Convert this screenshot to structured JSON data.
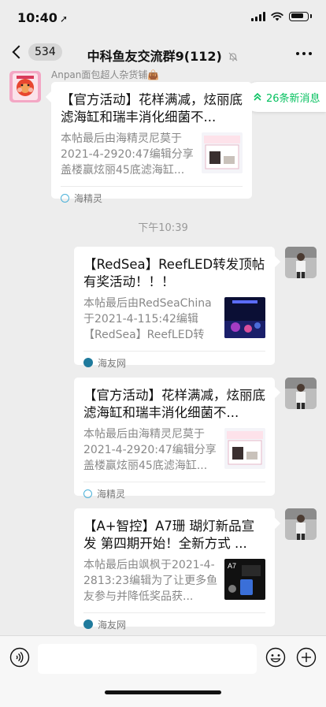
{
  "status_bar": {
    "time": "10:40",
    "location_icon": "location-arrow-icon"
  },
  "nav": {
    "back_count": "534",
    "title": "中科鱼友交流群9(112)",
    "mute_icon": "bell-off-icon",
    "more_icon": "more-dots-icon"
  },
  "new_messages": {
    "label": "26条新消息",
    "icon": "chevron-double-up-icon"
  },
  "sender": {
    "name": "Anpan面包超人杂货铺👜"
  },
  "time_divider": "下午10:39",
  "messages": [
    {
      "side": "left",
      "title": "【官方活动】花样满减，炫丽底滤海缸和瑞丰消化细菌不...",
      "desc": "本帖最后由海精灵尼莫于2021-4-2920:47编辑分享盖楼赢炫丽45底滤海缸...",
      "source": "海精灵"
    },
    {
      "side": "right",
      "title": "【RedSea】ReefLED转发顶帖有奖活动！！！",
      "desc": "本帖最后由RedSeaChina于2021-4-115:42编辑【RedSea】ReefLED转发...",
      "source": "海友网"
    },
    {
      "side": "right",
      "title": "【官方活动】花样满减，炫丽底滤海缸和瑞丰消化细菌不...",
      "desc": "本帖最后由海精灵尼莫于2021-4-2920:47编辑分享盖楼赢炫丽45底滤海缸...",
      "source": "海精灵"
    },
    {
      "side": "right",
      "title": "【A+智控】A7珊 瑚灯新品宣发  第四期开始！全新方式 ...",
      "desc": "本帖最后由飒枫于2021-4-2813:23编辑为了让更多鱼友参与并降低奖品获...",
      "source": "海友网"
    }
  ],
  "colors": {
    "accent": "#07c160",
    "background": "#ededed"
  }
}
